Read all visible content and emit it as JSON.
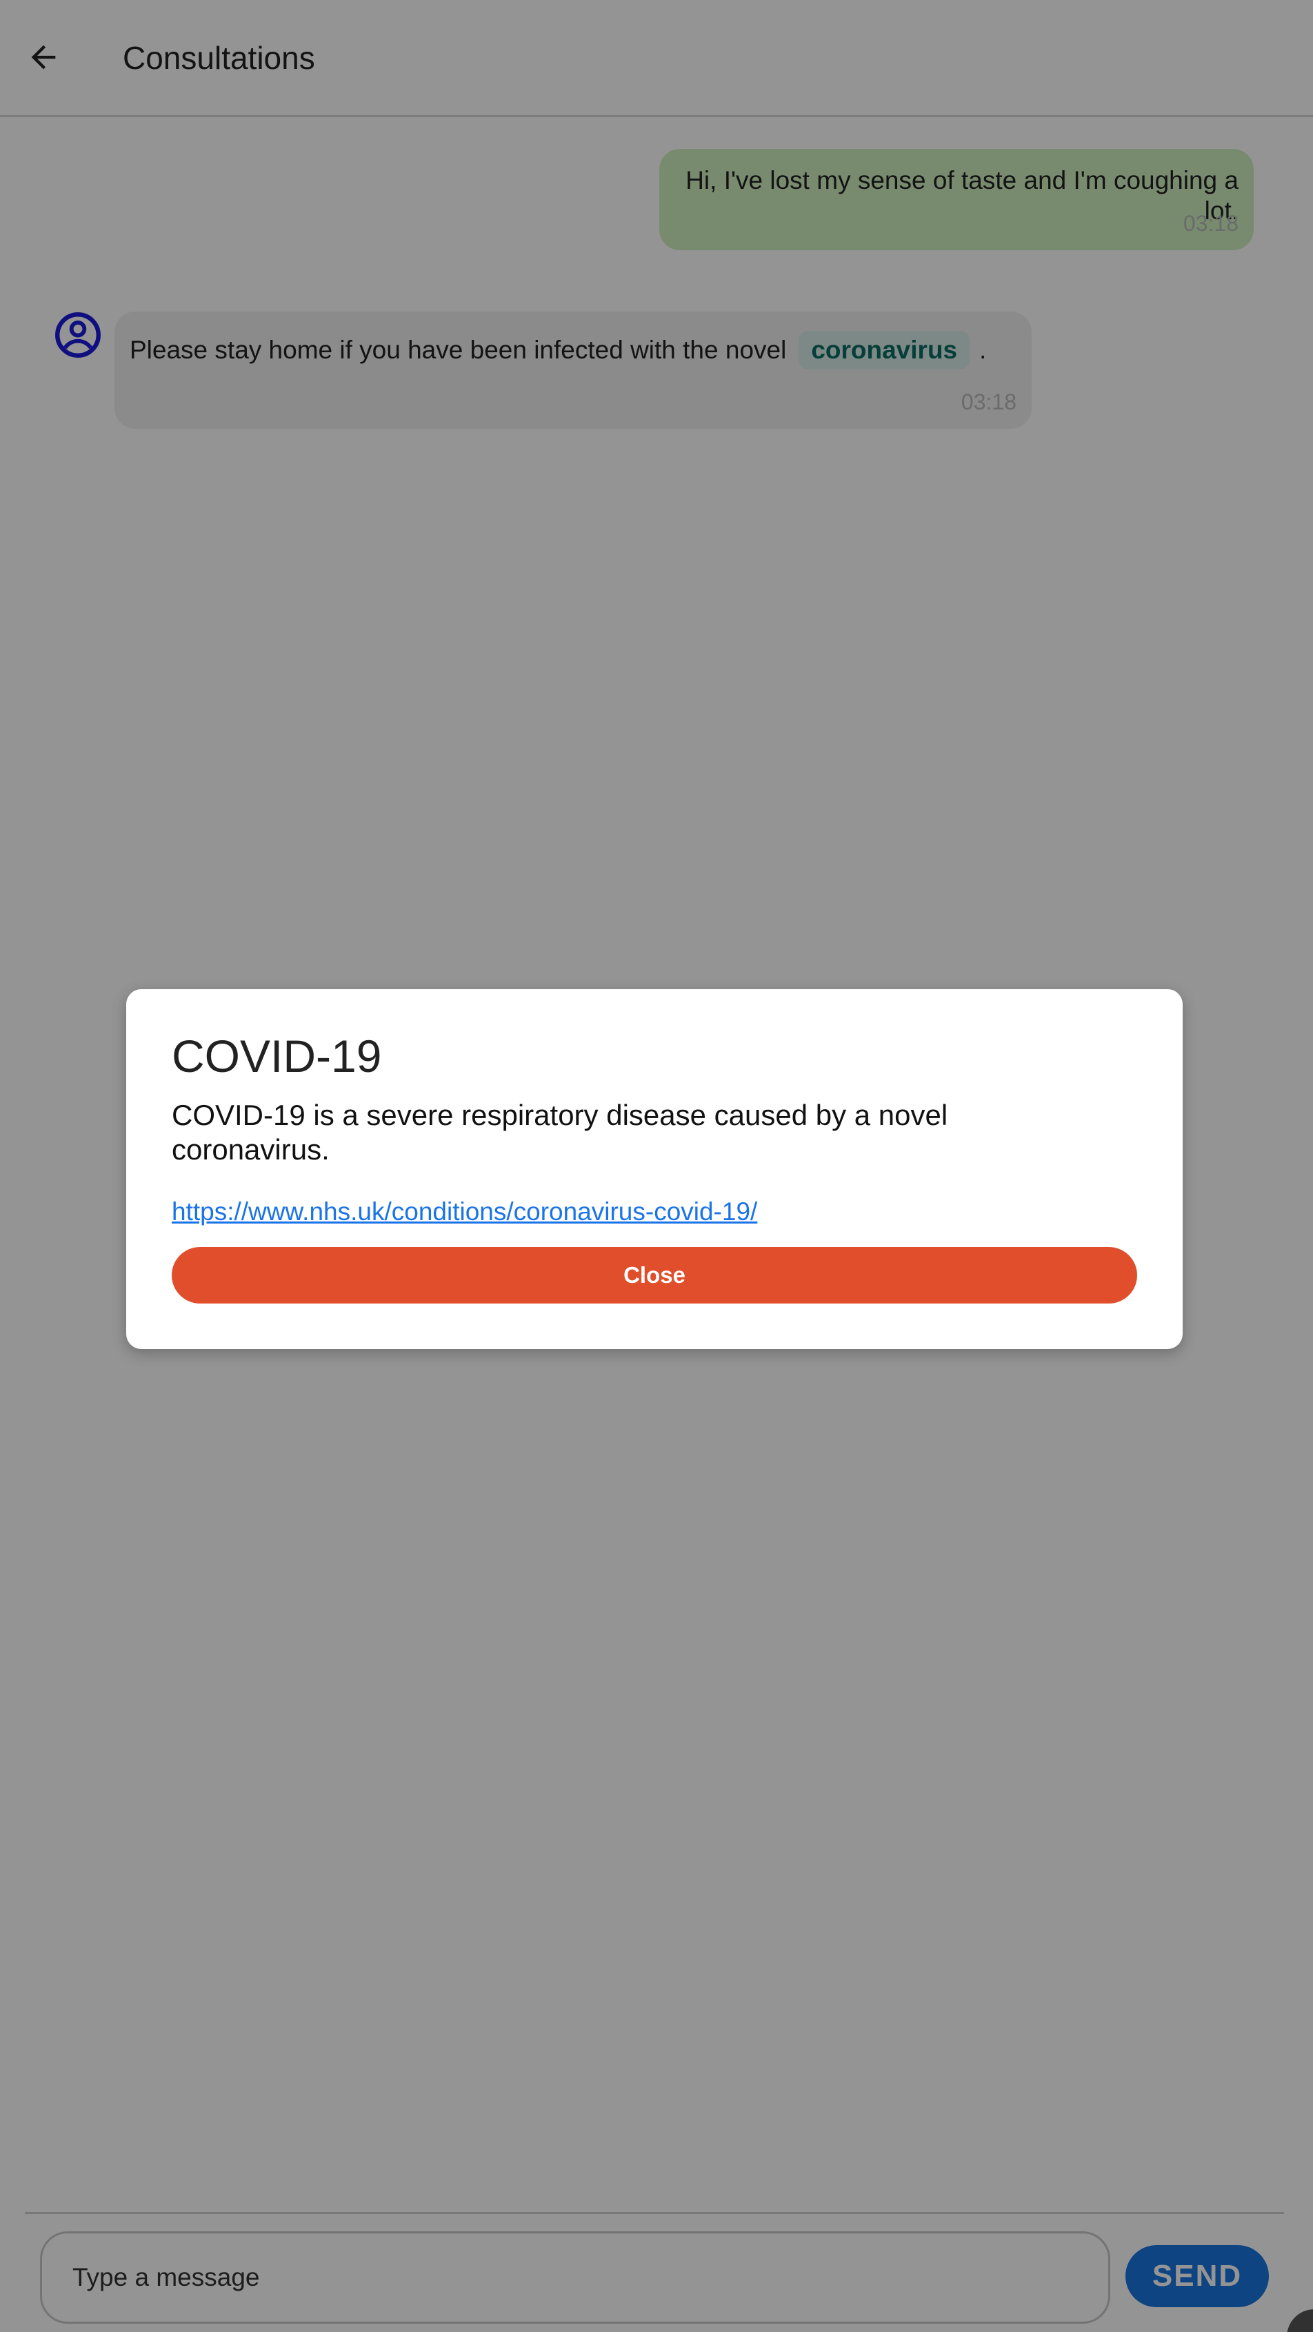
{
  "header": {
    "title": "Consultations",
    "back_icon": "arrow-left-icon"
  },
  "messages": [
    {
      "sender": "user",
      "text": "Hi, I've lost my sense of taste and I'm coughing a lot.",
      "time": "03:18"
    },
    {
      "sender": "bot",
      "text_before": "Please stay home if you have been infected with the novel",
      "keyword": "coronavirus",
      "text_after": ".",
      "time": "03:18",
      "avatar_icon": "account-circle-icon"
    }
  ],
  "composer": {
    "placeholder": "Type a message",
    "send_label": "SEND"
  },
  "modal": {
    "title": "COVID-19",
    "description": "COVID-19 is a severe respiratory disease caused by a novel coronavirus.",
    "link": "https://www.nhs.uk/conditions/coronavirus-covid-19/",
    "close_label": "Close"
  },
  "colors": {
    "user_bubble": "#d0f0c0",
    "bot_bubble": "#efefef",
    "keyword_chip": "#d7ece9",
    "keyword_text": "#0b6b63",
    "avatar": "#1a1adc",
    "send_button": "#1976e0",
    "close_button": "#e04e2b",
    "link": "#1a73e8"
  }
}
